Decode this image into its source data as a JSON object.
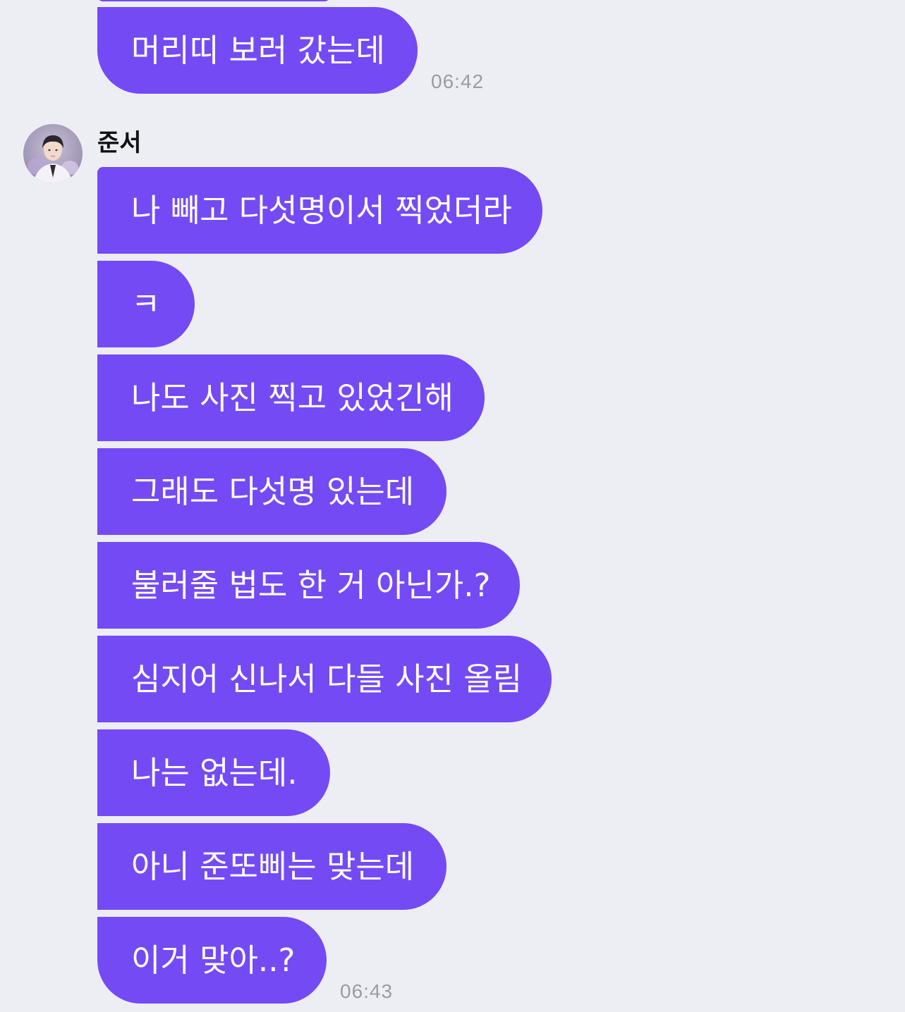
{
  "chat": {
    "prev_group": {
      "messages": [
        "머리띠 보러 갔는데"
      ],
      "time": "06:42"
    },
    "group": {
      "sender_name": "준서",
      "messages": [
        "나 빼고 다섯명이서 찍었더라",
        "ㅋ",
        "나도 사진 찍고 있었긴해",
        "그래도 다섯명 있는데",
        "불러줄 법도 한 거 아닌가.?",
        "심지어 신나서 다들 사진 올림",
        "나는 없는데.",
        "아니 준또삐는 맞는데",
        "이거 맞아..?"
      ],
      "time": "06:43"
    }
  },
  "colors": {
    "bubble": "#744af5",
    "background": "#eceef3",
    "timestamp": "#9a9ca4"
  }
}
